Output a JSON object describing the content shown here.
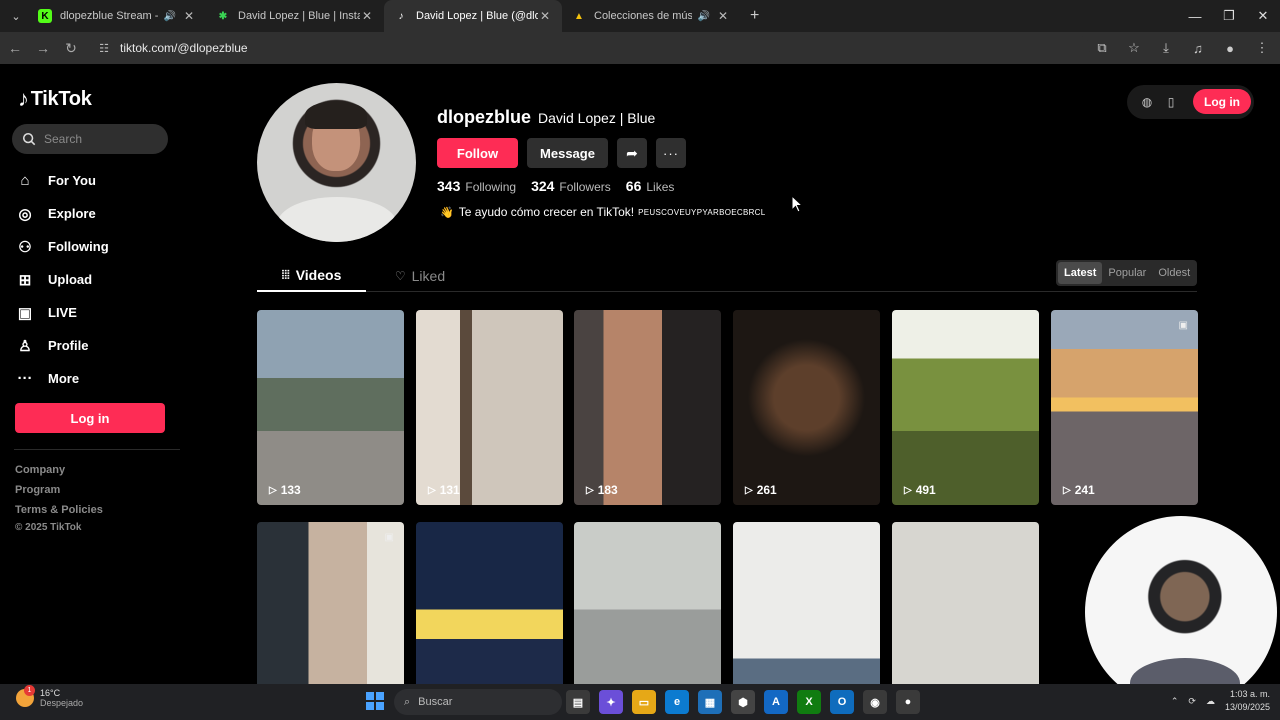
{
  "browser": {
    "tabs": [
      {
        "title": "dlopezblue Stream - Watch",
        "favicon": "K",
        "color": "#53fc18",
        "active": false,
        "audio": true
      },
      {
        "title": "David Lopez | Blue | Instagram",
        "favicon": "✱",
        "color": "#39d353",
        "active": false,
        "audio": false
      },
      {
        "title": "David Lopez | Blue (@dlopezblue)",
        "favicon": "♪",
        "color": "#000000",
        "active": true,
        "audio": false
      },
      {
        "title": "Colecciones de música ene",
        "favicon": "▲",
        "color": "#f4c20d",
        "active": false,
        "audio": true
      }
    ],
    "url": "tiktok.com/@dlopezblue"
  },
  "tiktok": {
    "logo": "TikTok",
    "search_placeholder": "Search",
    "nav": [
      {
        "label": "For You",
        "icon": "home-icon"
      },
      {
        "label": "Explore",
        "icon": "compass-icon"
      },
      {
        "label": "Following",
        "icon": "following-icon"
      },
      {
        "label": "Upload",
        "icon": "upload-icon"
      },
      {
        "label": "LIVE",
        "icon": "live-icon"
      },
      {
        "label": "Profile",
        "icon": "profile-icon"
      },
      {
        "label": "More",
        "icon": "more-icon"
      }
    ],
    "login_label": "Log in",
    "footer": [
      "Company",
      "Program",
      "Terms & Policies"
    ],
    "copyright": "© 2025 TikTok",
    "top_login_label": "Log in"
  },
  "profile": {
    "username": "dlopezblue",
    "nickname": "David Lopez | Blue",
    "follow_label": "Follow",
    "message_label": "Message",
    "following_count": "343",
    "following_label": "Following",
    "followers_count": "324",
    "followers_label": "Followers",
    "likes_count": "66",
    "likes_label": "Likes",
    "bio_emoji": "👋",
    "bio": "Te ayudo cómo crecer en TikTok!",
    "bio_tag": "PEUSCOVEUYPYARBOECBRCL"
  },
  "tabs": {
    "videos_label": "Videos",
    "liked_label": "Liked",
    "sort": [
      "Latest",
      "Popular",
      "Oldest"
    ],
    "sort_selected": "Latest"
  },
  "videos": [
    {
      "views": "133"
    },
    {
      "views": "131"
    },
    {
      "views": "183"
    },
    {
      "views": "261"
    },
    {
      "views": "491"
    },
    {
      "views": "241"
    },
    {
      "views": ""
    },
    {
      "views": ""
    },
    {
      "views": ""
    },
    {
      "views": ""
    },
    {
      "views": ""
    }
  ],
  "taskbar": {
    "weather_temp": "16°C",
    "weather_desc": "Despejado",
    "weather_badge": "1",
    "search_placeholder": "Buscar",
    "time": "1:03 a. m.",
    "date": "13/09/2025"
  }
}
